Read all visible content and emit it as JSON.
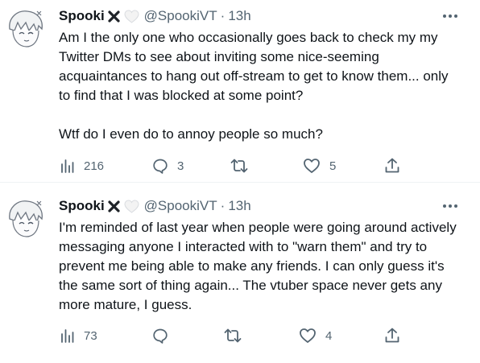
{
  "tweets": [
    {
      "author_name": "Spooki",
      "handle": "@SpookiVT",
      "separator": "·",
      "time": "13h",
      "body": [
        "Am I the only one who occasionally goes back to check my my Twitter DMs to see about inviting some nice-seeming acquaintances to hang out off-stream to get to know them... only to find that I was blocked at some point?",
        "Wtf do I even do to annoy people so much?"
      ],
      "views": "216",
      "replies": "3",
      "retweets": "",
      "likes": "5"
    },
    {
      "author_name": "Spooki",
      "handle": "@SpookiVT",
      "separator": "·",
      "time": "13h",
      "body": [
        "I'm reminded of last year when people were going around actively messaging anyone I interacted with to \"warn them\" and try to prevent me being able to make any friends. I can only guess it's the same sort of thing again... The vtuber space never gets any more mature, I guess."
      ],
      "views": "73",
      "replies": "",
      "retweets": "",
      "likes": "4"
    }
  ],
  "icons": {
    "name_emoji_1": "cross-mark-icon",
    "name_emoji_2": "white-heart-icon",
    "more": "more-icon",
    "views": "views-icon",
    "reply": "reply-icon",
    "retweet": "retweet-icon",
    "like": "like-icon",
    "share": "share-icon"
  },
  "colors": {
    "text": "#0f1419",
    "secondary": "#536471",
    "divider": "#eff3f4"
  }
}
